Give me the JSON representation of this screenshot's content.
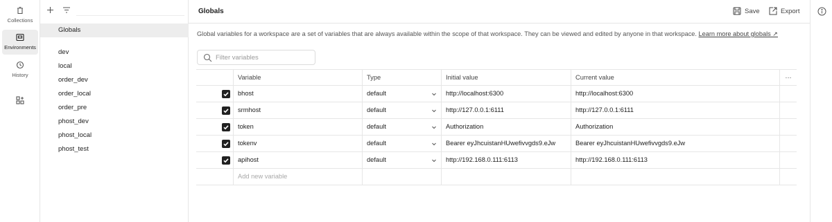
{
  "rail": {
    "items": [
      {
        "label": "Collections",
        "icon": "trash-icon"
      },
      {
        "label": "Environments",
        "icon": "environment-icon"
      },
      {
        "label": "History",
        "icon": "history-icon"
      },
      {
        "label": "",
        "icon": "add-widgets-icon"
      }
    ]
  },
  "envlist": {
    "globals_label": "Globals",
    "items": [
      "dev",
      "local",
      "order_dev",
      "order_local",
      "order_pre",
      "phost_dev",
      "phost_local",
      "phost_test"
    ]
  },
  "header": {
    "title": "Globals",
    "save_label": "Save",
    "export_label": "Export"
  },
  "description": {
    "text": "Global variables for a workspace are a set of variables that are always available within the scope of that workspace. They can be viewed and edited by anyone in that workspace.",
    "link": "Learn more about globals ↗"
  },
  "filter": {
    "placeholder": "Filter variables"
  },
  "table": {
    "headers": {
      "variable": "Variable",
      "type": "Type",
      "initial": "Initial value",
      "current": "Current value",
      "more": "···"
    },
    "rows": [
      {
        "checked": true,
        "variable": "bhost",
        "type": "default",
        "initial": "http://localhost:6300",
        "current": "http://localhost:6300"
      },
      {
        "checked": true,
        "variable": "srmhost",
        "type": "default",
        "initial": "http://127.0.0.1:6111",
        "current": "http://127.0.0.1:6111"
      },
      {
        "checked": true,
        "variable": "token",
        "type": "default",
        "initial": "Authorization",
        "current": "Authorization"
      },
      {
        "checked": true,
        "variable": "tokenv",
        "type": "default",
        "initial": "Bearer eyJhcuistanHUwefivvgds9.eJw",
        "current": "Bearer eyJhcuistanHUwefivvgds9.eJw"
      },
      {
        "checked": true,
        "variable": "apihost",
        "type": "default",
        "initial": "http://192.168.0.111:6113",
        "current": "http://192.168.0.111:6113"
      }
    ],
    "add_placeholder": "Add new variable"
  }
}
